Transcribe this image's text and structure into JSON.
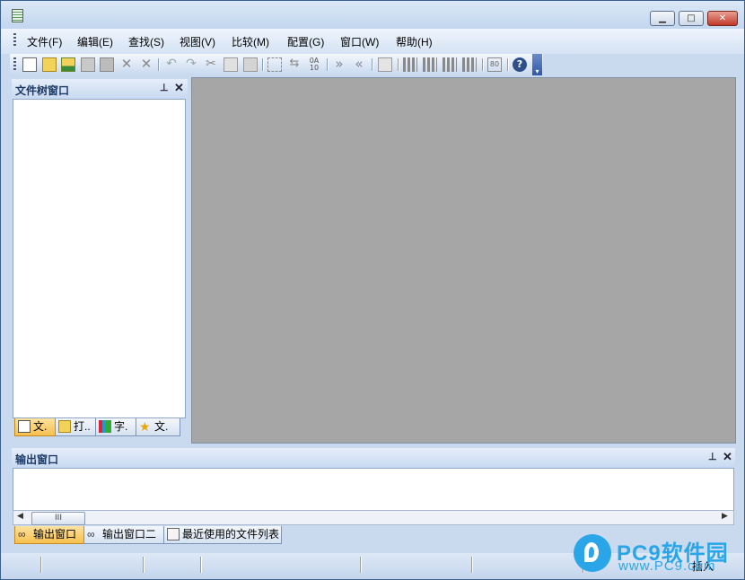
{
  "menu": {
    "items": [
      "文件(F)",
      "编辑(E)",
      "查找(S)",
      "视图(V)",
      "比较(M)",
      "配置(G)",
      "窗口(W)",
      "帮助(H)"
    ]
  },
  "toolbar": {
    "icons": [
      "new-file-icon",
      "open-folder-icon",
      "open-project-icon",
      "save-icon",
      "save-all-icon",
      "close-icon",
      "close-all-icon",
      "undo-icon",
      "redo-icon",
      "cut-icon",
      "copy-icon",
      "paste-icon",
      "select-icon",
      "swap-icon",
      "sort-icon",
      "next-diff-icon",
      "prev-diff-icon",
      "delete-icon",
      "compare-icon",
      "compare-left-icon",
      "compare-right-icon",
      "merge-icon",
      "hex-icon",
      "help-icon"
    ]
  },
  "file_tree": {
    "title": "文件树窗口",
    "tabs": [
      "文.",
      "打..",
      "字.",
      "文."
    ]
  },
  "output": {
    "title": "输出窗口",
    "scroll_thumb": "III",
    "tabs": [
      "输出窗口",
      "输出窗口二",
      "最近使用的文件列表"
    ]
  },
  "status": {
    "mode": "插入"
  },
  "watermark": {
    "title": "PC9软件园",
    "url": "www.PC9.com"
  },
  "colors": {
    "active_tab": "#f6c04e",
    "workspace": "#a6a6a6",
    "watermark": "#2aa6e8"
  }
}
